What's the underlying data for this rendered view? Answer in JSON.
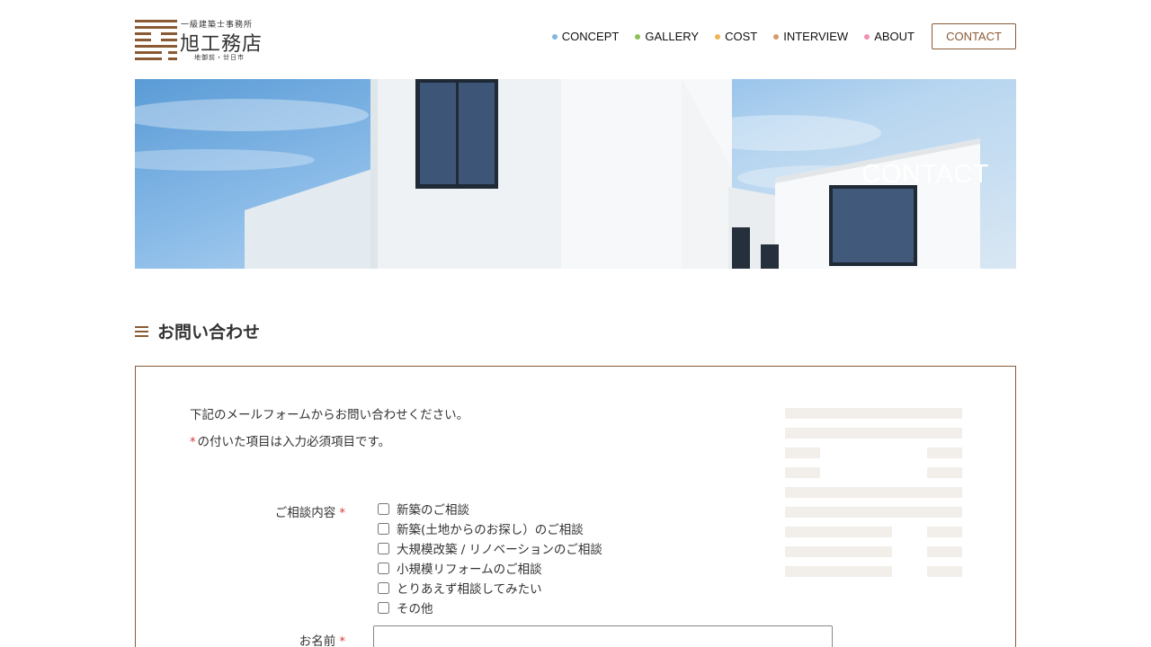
{
  "logo": {
    "subtitle": "一級建築士事務所",
    "name": "旭工務店",
    "location": "地御前・廿日市"
  },
  "nav": {
    "items": [
      {
        "label": "CONCEPT",
        "dot_color": "#7fb7e0"
      },
      {
        "label": "GALLERY",
        "dot_color": "#8cc152"
      },
      {
        "label": "COST",
        "dot_color": "#f0b450"
      },
      {
        "label": "INTERVIEW",
        "dot_color": "#d79a6a"
      },
      {
        "label": "ABOUT",
        "dot_color": "#f090b0"
      }
    ],
    "contact_label": "CONTACT"
  },
  "hero": {
    "title": "CONTACT"
  },
  "section": {
    "title": "お問い合わせ"
  },
  "form": {
    "intro": "下記のメールフォームからお問い合わせください。",
    "required_star": "*",
    "required_note": "の付いた項目は入力必須項目です。",
    "consult_label": "ご相談内容",
    "consult_options": [
      "新築のご相談",
      "新築(土地からのお探し）のご相談",
      "大規模改築 / リノベーションのご相談",
      "小規模リフォームのご相談",
      "とりあえず相談してみたい",
      "その他"
    ],
    "name_label": "お名前",
    "name_value": ""
  },
  "colors": {
    "brand": "#8a5a34",
    "required": "#dd3333",
    "watermark": "#f2eeea"
  }
}
